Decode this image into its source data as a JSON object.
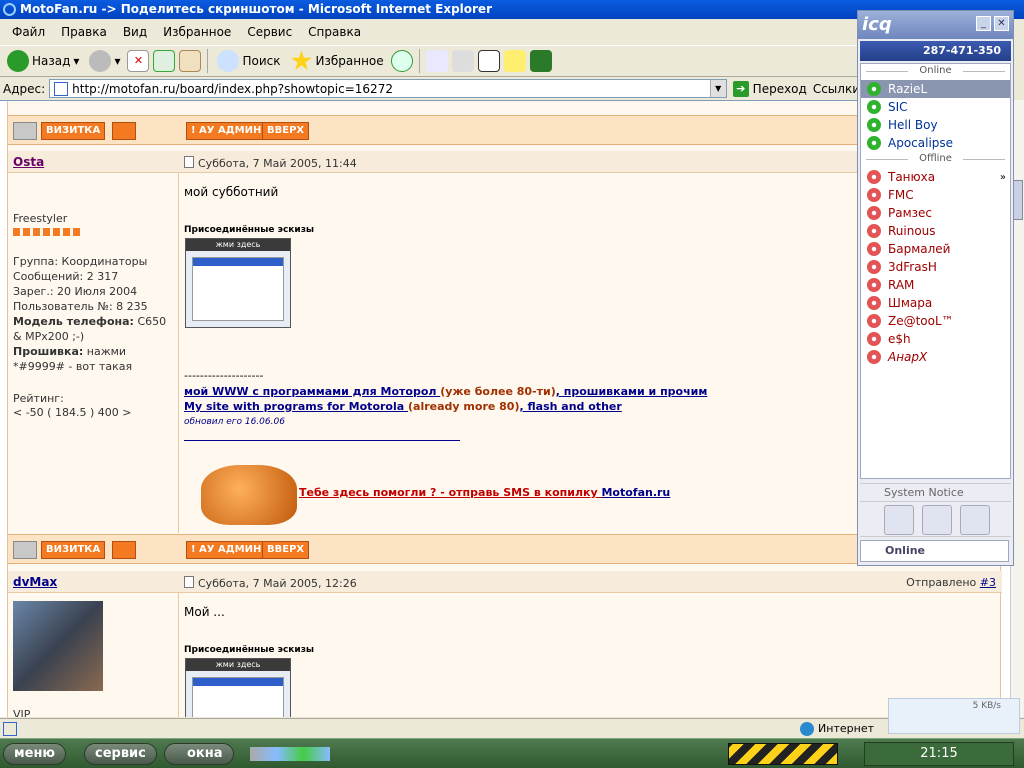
{
  "window": {
    "title": "MotoFan.ru -> Поделитесь скриншотом - Microsoft Internet Explorer"
  },
  "menu": [
    "Файл",
    "Правка",
    "Вид",
    "Избранное",
    "Сервис",
    "Справка"
  ],
  "toolbar": {
    "back": "Назад",
    "search": "Поиск",
    "favorites": "Избранное"
  },
  "address": {
    "label": "Адрес:",
    "url": "http://motofan.ru/board/index.php?showtopic=16272",
    "go": "Переход",
    "links": "Ссылки"
  },
  "buttons": {
    "card": "ВИЗИТКА",
    "to_admin": "! AУ АДМИН",
    "up": "ВВЕРХ"
  },
  "posts": [
    {
      "author": "Osta",
      "date": "Суббота, 7 Май 2005, 11:44",
      "title": "Freestyler",
      "group": "Группа: Координаторы",
      "messages": "Сообщений: 2 317",
      "registered": "Зарег.: 20 Июля 2004",
      "user_no": "Пользователь №: 8 235",
      "phone_label": "Модель телефона:",
      "phone": "C650 & MPx200 ;-)",
      "firmware_label": "Прошивка:",
      "firmware": "нажми *#9999# - вот такая",
      "rating_label": "Рейтинг:",
      "rating": "< -50 ( 184.5 ) 400 >",
      "body": "мой субботний",
      "sketches": "Присоединённые эскизы",
      "thumb_label": "жми здесь",
      "divider": "--------------------",
      "sig1_a": "мой WWW с программами для Моторол ",
      "sig1_b": "(уже более 80-ти)",
      "sig1_c": ", прошивками и прочим",
      "sig2_a": "My site with programs for Motorola ",
      "sig2_b": "(already more 80)",
      "sig2_c": ", flash and other",
      "updated": "обновил его 16.06.06",
      "sms_text": "Тебе здесь помогли ? - отправь SMS в копилку ",
      "sms_link": "Motofan.ru"
    },
    {
      "author": "dvMax",
      "date": "Суббота, 7 Май 2005, 12:26",
      "sent": "Отправлено ",
      "sent_no": "#3",
      "body": "Мой ...",
      "sketches": "Присоединённые эскизы",
      "thumb_label": "жми здесь",
      "title_partial": "VIP"
    }
  ],
  "statusbar": {
    "zone": "Интернет"
  },
  "taskbar": {
    "menu": "меню",
    "service": "сервис",
    "windows": "окна",
    "clock": "21:15"
  },
  "icq": {
    "title": "icq",
    "number": "287-471-350",
    "online_header": "Online",
    "offline_header": "Offline",
    "online": [
      "RazieL",
      "SIC",
      "Hell Boy",
      "Apocalipse"
    ],
    "offline": [
      "Танюха",
      "FMC",
      "Рамзес",
      "Ruinous",
      "Бармалей",
      "3dFrasH",
      "RAM",
      "Шмара",
      "Ze@tooL™",
      "e$h",
      "АнарХ"
    ],
    "system_notice": "System Notice",
    "status": "Online",
    "speed": "5 KB/s"
  }
}
